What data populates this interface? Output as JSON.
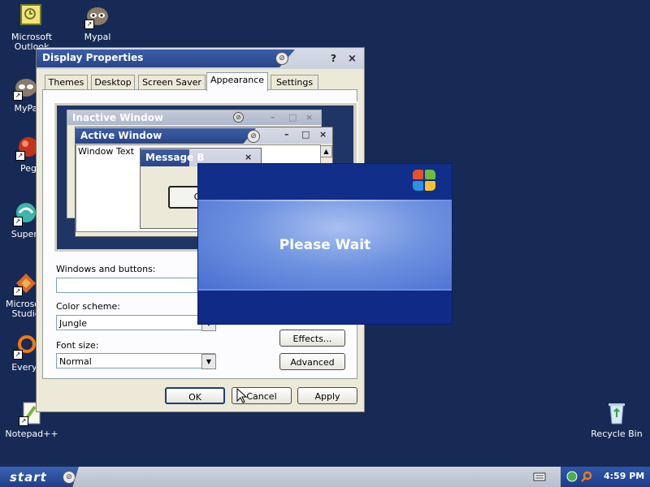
{
  "desktop": {
    "icons": [
      {
        "label": "Microsoft Outlook",
        "icon": "outlook-icon"
      },
      {
        "label": "Mypal",
        "icon": "mypal-icon"
      },
      {
        "label": "MyPa",
        "icon": "mypal-icon"
      },
      {
        "label": "Peg",
        "icon": "pegasus-icon"
      },
      {
        "label": "Superr",
        "icon": "super-icon"
      },
      {
        "label": "Microsoft Studio",
        "icon": "visual-studio-icon"
      },
      {
        "label": "Everyt",
        "icon": "everything-search-icon"
      },
      {
        "label": "Notepad++",
        "icon": "notepad-plus-plus-icon"
      },
      {
        "label": "Recycle Bin",
        "icon": "recycle-bin-icon"
      }
    ]
  },
  "dialog": {
    "title": "Display Properties",
    "help": "?",
    "close": "×",
    "tabs": [
      {
        "label": "Themes"
      },
      {
        "label": "Desktop"
      },
      {
        "label": "Screen Saver"
      },
      {
        "label": "Appearance",
        "active": true
      },
      {
        "label": "Settings"
      }
    ],
    "preview": {
      "inactive_title": "Inactive Window",
      "active_title": "Active Window",
      "window_text": "Window Text",
      "message_title": "Message B",
      "message_ok": "O"
    },
    "fields": {
      "windows_buttons_label": "Windows and buttons:",
      "windows_buttons_value": "",
      "color_scheme_label": "Color scheme:",
      "color_scheme_value": "Jungle",
      "font_size_label": "Font size:",
      "font_size_value": "Normal"
    },
    "side_buttons": {
      "effects": "Effects...",
      "advanced": "Advanced"
    },
    "footer": {
      "ok": "OK",
      "cancel": "Cancel",
      "apply": "Apply"
    }
  },
  "overlay": {
    "message": "Please Wait"
  },
  "taskbar": {
    "start": "start",
    "clock": "4:59 PM"
  },
  "colors": {
    "desktop": "#172a55",
    "title_blue": "#2a4586",
    "dialog_face": "#ece9d8",
    "wait_blue": "#4a6fd1"
  }
}
